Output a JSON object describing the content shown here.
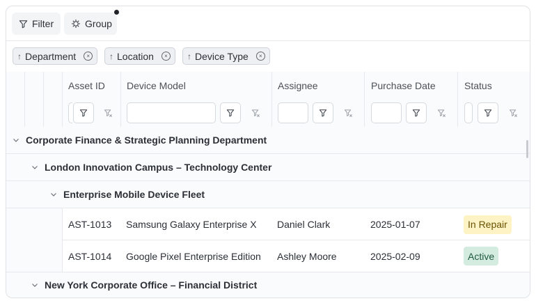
{
  "toolbar": {
    "filter_label": "Filter",
    "group_label": "Group"
  },
  "grouping": [
    {
      "label": "Department",
      "direction": "asc"
    },
    {
      "label": "Location",
      "direction": "asc"
    },
    {
      "label": "Device Type",
      "direction": "asc"
    }
  ],
  "columns": [
    "Asset ID",
    "Device Model",
    "Assignee",
    "Purchase Date",
    "Status"
  ],
  "groups": {
    "department": "Corporate Finance & Strategic Planning Department",
    "location_1": "London Innovation Campus – Technology Center",
    "device_type": "Enterprise Mobile Device Fleet",
    "location_2": "New York Corporate Office – Financial District"
  },
  "rows": [
    {
      "asset_id": "AST-1013",
      "model": "Samsung Galaxy Enterprise X",
      "assignee": "Daniel Clark",
      "date": "2025-01-07",
      "status": "In Repair"
    },
    {
      "asset_id": "AST-1014",
      "model": "Google Pixel Enterprise Edition",
      "assignee": "Ashley Moore",
      "date": "2025-02-09",
      "status": "Active"
    }
  ],
  "status_colors": {
    "in_repair_bg": "#fdf3c4",
    "in_repair_fg": "#6b5200",
    "active_bg": "#d4ece0",
    "active_fg": "#1f5a3d"
  }
}
